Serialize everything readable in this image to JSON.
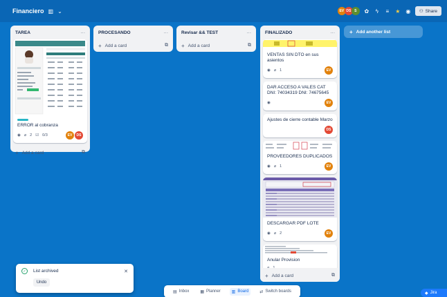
{
  "header": {
    "board_title": "Financiero",
    "avatars": [
      {
        "initials": "EV",
        "color": "#e2820c"
      },
      {
        "initials": "DS",
        "color": "#e34935"
      },
      {
        "initials": "S",
        "color": "#5e8f2f"
      }
    ],
    "share_label": "Share"
  },
  "lists": [
    {
      "title": "TAREA",
      "cards": [
        {
          "title": "ERROR al cobranza",
          "attachments": "2",
          "checklist": "0/3",
          "avatars": [
            "EV",
            "DS"
          ]
        }
      ],
      "add_card": "Add a card"
    },
    {
      "title": "PROCESANDO",
      "add_card": "Add a card"
    },
    {
      "title": "Revisar && TEST",
      "add_card": "Add a card"
    },
    {
      "title": "FINALIZADO",
      "cards": [
        {
          "title": "VENTAS SIN DTO en sus asientos",
          "attachments": "1",
          "avatars": [
            "EV"
          ]
        },
        {
          "title": "DAR ACCESO A VALES CAT DNI: 74034319 DNI: 74675645",
          "avatars": [
            "EV"
          ]
        },
        {
          "title": "Ajustes de cierre contable Marzo",
          "avatars": [
            "DS"
          ]
        },
        {
          "title": "PROVEEDORES DUPLICADOS",
          "attachments": "1",
          "avatars": [
            "EV"
          ]
        },
        {
          "title": "DESCARGAR PDF LOTE",
          "attachments": "2",
          "avatars": [
            "EV"
          ]
        },
        {
          "title": "Anular Provision",
          "attachments": "1"
        }
      ],
      "add_card": "Add a card"
    }
  ],
  "add_list": "Add another list",
  "bottom_bar": {
    "inbox": "Inbox",
    "planner": "Planner",
    "board": "Board",
    "switch": "Switch boards"
  },
  "toast": {
    "message": "List archived",
    "undo": "Undo"
  },
  "jira": "Jira",
  "colors": {
    "background": "#0a74c8",
    "header": "#0a66b5",
    "EV": "#e2820c",
    "DS": "#e34935"
  }
}
